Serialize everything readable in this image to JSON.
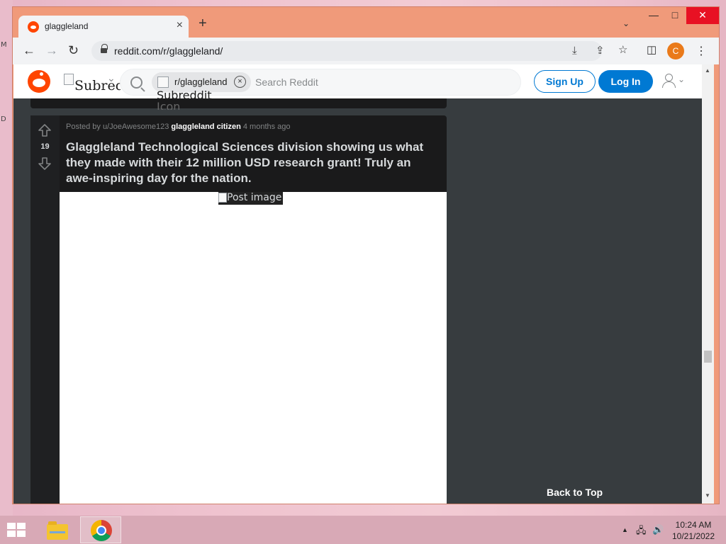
{
  "desktop": {
    "marks": [
      "M",
      "D"
    ]
  },
  "browser": {
    "tab": {
      "title": "glaggleland",
      "close": "×"
    },
    "new_tab": "+",
    "tab_search": "⌄",
    "window_controls": {
      "minimize": "—",
      "maximize": "□",
      "close": "✕"
    },
    "nav": {
      "back": "←",
      "forward": "→",
      "reload": "↻"
    },
    "url": "reddit.com/r/glaggleland/",
    "omnibox_icons": {
      "install": "⤓",
      "share": "⇪",
      "bookmark": "☆"
    },
    "side_panel": "◫",
    "profile_initial": "C",
    "menu": "⋮"
  },
  "reddit_header": {
    "subreddit_alt": "Subreddit",
    "chevron": "⌄",
    "search_chip": {
      "label": "r/glaggleland",
      "close": "×",
      "icon_alt_line1": "Subreddit",
      "icon_alt_line2": "Icon"
    },
    "search_placeholder": "Search Reddit",
    "signup": "Sign Up",
    "login": "Log In",
    "user_chevron": "⌄"
  },
  "post": {
    "posted_by": "Posted by u/JoeAwesome123",
    "flair": "glaggleland citizen",
    "age": "4 months ago",
    "votes": "19",
    "title": "Glaggleland Technological Sciences division showing us what they made with their 12 million USD research grant! Truly an awe-inspiring day for the nation.",
    "image_alt": "Post image"
  },
  "sidebar": {
    "back_to_top": "Back to Top"
  },
  "scrollbar": {
    "up": "▲",
    "down": "▼"
  },
  "taskbar": {
    "tray_arrow": "▲",
    "network": "🖧",
    "volume": "🔊",
    "time": "10:24 AM",
    "date": "10/21/2022"
  },
  "colors": {
    "reddit_orange": "#ff4500",
    "reddit_blue": "#0079d3",
    "window_frame": "#f09a7a"
  }
}
